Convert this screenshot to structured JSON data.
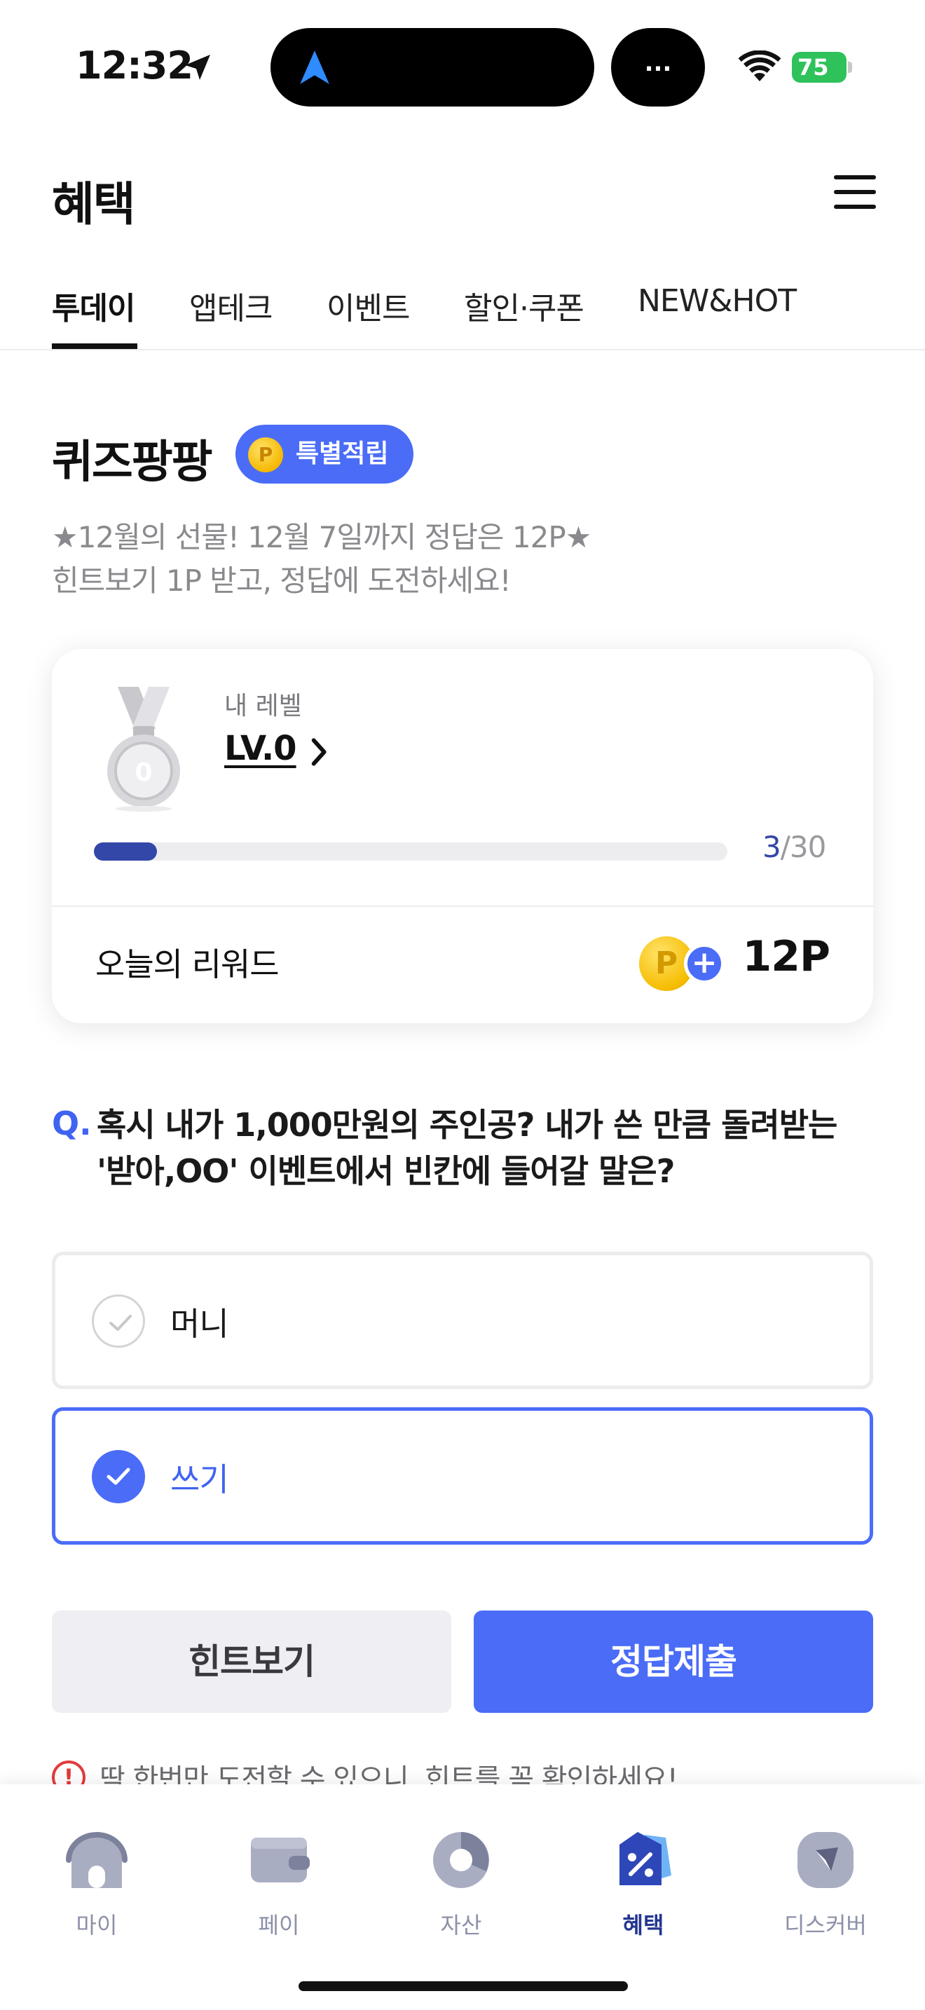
{
  "status_bar": {
    "time": "12:32",
    "island_text": "...",
    "battery": "75"
  },
  "header": {
    "title": "혜택"
  },
  "tabs": [
    {
      "label": "투데이",
      "active": true
    },
    {
      "label": "앱테크",
      "active": false
    },
    {
      "label": "이벤트",
      "active": false
    },
    {
      "label": "할인·쿠폰",
      "active": false
    },
    {
      "label": "NEW&HOT",
      "active": false
    }
  ],
  "quiz": {
    "title": "퀴즈팡팡",
    "badge": "특별적립",
    "badge_coin": "P",
    "subtitle_line1": "★12월의 선물! 12월 7일까지 정답은 12P★",
    "subtitle_line2": "힌트보기 1P 받고, 정답에 도전하세요!"
  },
  "level_card": {
    "medal_level": "0",
    "level_label": "내 레벨",
    "level_value": "LV.0",
    "progress_current": "3",
    "progress_total": "/30",
    "progress_fraction": 0.1,
    "reward_label": "오늘의 리워드",
    "reward_coin": "P",
    "reward_plus": "+",
    "reward_value": "12P"
  },
  "question": {
    "prefix": "Q.",
    "text": "혹시 내가 1,000만원의 주인공? 내가 쓴 만큼 돌려받는 '받아,OO' 이벤트에서 빈칸에 들어갈 말은?"
  },
  "options": [
    {
      "label": "머니",
      "selected": false
    },
    {
      "label": "쓰기",
      "selected": true
    }
  ],
  "buttons": {
    "hint": "힌트보기",
    "submit": "정답제출"
  },
  "warning": {
    "icon": "!",
    "text": "딱 한번만 도전할 수 있으니, 힌트를 꼭 확인하세요!"
  },
  "bottom_nav": [
    {
      "label": "마이",
      "icon": "home-icon",
      "active": false
    },
    {
      "label": "페이",
      "icon": "wallet-icon",
      "active": false
    },
    {
      "label": "자산",
      "icon": "pie-chart-icon",
      "active": false
    },
    {
      "label": "혜택",
      "icon": "benefit-tag-icon",
      "active": true
    },
    {
      "label": "디스커버",
      "icon": "compass-icon",
      "active": false
    }
  ],
  "colors": {
    "accent": "#4a6cf7",
    "accent_dark": "#3347a8",
    "nav_active": "#233691",
    "warning": "#e23b3b"
  }
}
